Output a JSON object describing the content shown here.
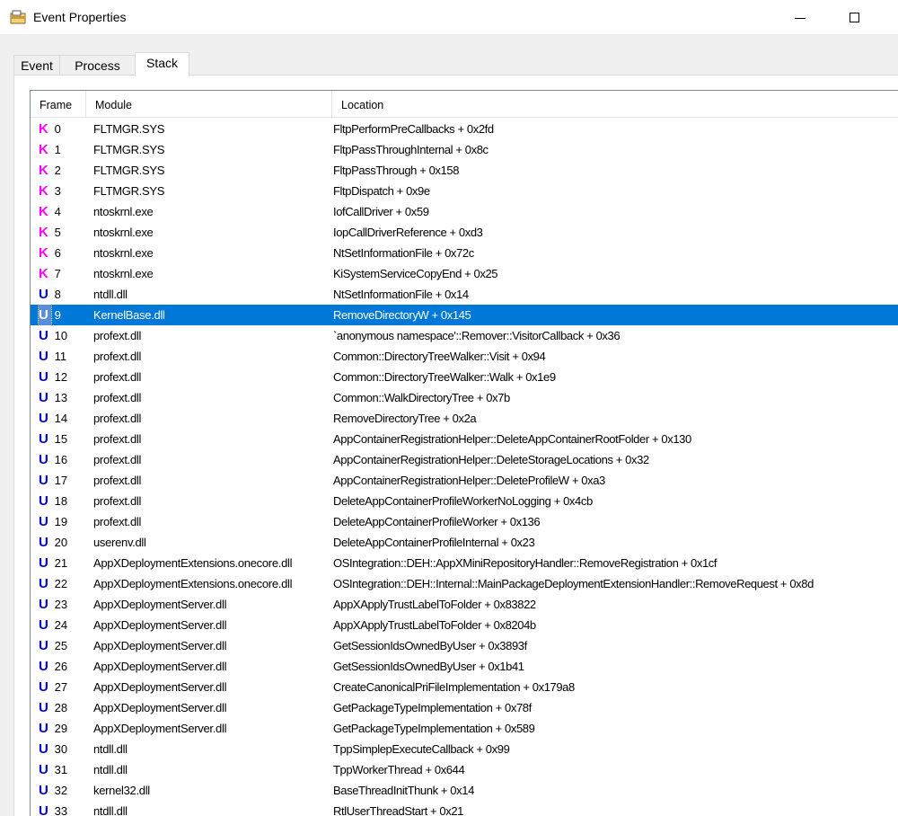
{
  "window": {
    "title": "Event Properties",
    "icon": "event-properties-icon"
  },
  "tabs": [
    {
      "label": "Event",
      "active": false
    },
    {
      "label": "Process",
      "active": false
    },
    {
      "label": "Stack",
      "active": true
    }
  ],
  "columns": {
    "frame": "Frame",
    "module": "Module",
    "location": "Location"
  },
  "mode_colors": {
    "K": "#ff00ff",
    "U": "#0000cc"
  },
  "selected_frame": 9,
  "rows": [
    {
      "mode": "K",
      "frame": "0",
      "module": "FLTMGR.SYS",
      "location": "FltpPerformPreCallbacks + 0x2fd"
    },
    {
      "mode": "K",
      "frame": "1",
      "module": "FLTMGR.SYS",
      "location": "FltpPassThroughInternal + 0x8c"
    },
    {
      "mode": "K",
      "frame": "2",
      "module": "FLTMGR.SYS",
      "location": "FltpPassThrough + 0x158"
    },
    {
      "mode": "K",
      "frame": "3",
      "module": "FLTMGR.SYS",
      "location": "FltpDispatch + 0x9e"
    },
    {
      "mode": "K",
      "frame": "4",
      "module": "ntoskrnl.exe",
      "location": "IofCallDriver + 0x59"
    },
    {
      "mode": "K",
      "frame": "5",
      "module": "ntoskrnl.exe",
      "location": "IopCallDriverReference + 0xd3"
    },
    {
      "mode": "K",
      "frame": "6",
      "module": "ntoskrnl.exe",
      "location": "NtSetInformationFile + 0x72c"
    },
    {
      "mode": "K",
      "frame": "7",
      "module": "ntoskrnl.exe",
      "location": "KiSystemServiceCopyEnd + 0x25"
    },
    {
      "mode": "U",
      "frame": "8",
      "module": "ntdll.dll",
      "location": "NtSetInformationFile + 0x14"
    },
    {
      "mode": "U",
      "frame": "9",
      "module": "KernelBase.dll",
      "location": "RemoveDirectoryW + 0x145"
    },
    {
      "mode": "U",
      "frame": "10",
      "module": "profext.dll",
      "location": "`anonymous namespace'::Remover::VisitorCallback + 0x36"
    },
    {
      "mode": "U",
      "frame": "11",
      "module": "profext.dll",
      "location": "Common::DirectoryTreeWalker::Visit + 0x94"
    },
    {
      "mode": "U",
      "frame": "12",
      "module": "profext.dll",
      "location": "Common::DirectoryTreeWalker::Walk + 0x1e9"
    },
    {
      "mode": "U",
      "frame": "13",
      "module": "profext.dll",
      "location": "Common::WalkDirectoryTree + 0x7b"
    },
    {
      "mode": "U",
      "frame": "14",
      "module": "profext.dll",
      "location": "RemoveDirectoryTree + 0x2a"
    },
    {
      "mode": "U",
      "frame": "15",
      "module": "profext.dll",
      "location": "AppContainerRegistrationHelper::DeleteAppContainerRootFolder + 0x130"
    },
    {
      "mode": "U",
      "frame": "16",
      "module": "profext.dll",
      "location": "AppContainerRegistrationHelper::DeleteStorageLocations + 0x32"
    },
    {
      "mode": "U",
      "frame": "17",
      "module": "profext.dll",
      "location": "AppContainerRegistrationHelper::DeleteProfileW + 0xa3"
    },
    {
      "mode": "U",
      "frame": "18",
      "module": "profext.dll",
      "location": "DeleteAppContainerProfileWorkerNoLogging + 0x4cb"
    },
    {
      "mode": "U",
      "frame": "19",
      "module": "profext.dll",
      "location": "DeleteAppContainerProfileWorker + 0x136"
    },
    {
      "mode": "U",
      "frame": "20",
      "module": "userenv.dll",
      "location": "DeleteAppContainerProfileInternal + 0x23"
    },
    {
      "mode": "U",
      "frame": "21",
      "module": "AppXDeploymentExtensions.onecore.dll",
      "location": "OSIntegration::DEH::AppXMiniRepositoryHandler::RemoveRegistration + 0x1cf"
    },
    {
      "mode": "U",
      "frame": "22",
      "module": "AppXDeploymentExtensions.onecore.dll",
      "location": "OSIntegration::DEH::Internal::MainPackageDeploymentExtensionHandler::RemoveRequest + 0x8d"
    },
    {
      "mode": "U",
      "frame": "23",
      "module": "AppXDeploymentServer.dll",
      "location": "AppXApplyTrustLabelToFolder + 0x83822"
    },
    {
      "mode": "U",
      "frame": "24",
      "module": "AppXDeploymentServer.dll",
      "location": "AppXApplyTrustLabelToFolder + 0x8204b"
    },
    {
      "mode": "U",
      "frame": "25",
      "module": "AppXDeploymentServer.dll",
      "location": "GetSessionIdsOwnedByUser + 0x3893f"
    },
    {
      "mode": "U",
      "frame": "26",
      "module": "AppXDeploymentServer.dll",
      "location": "GetSessionIdsOwnedByUser + 0x1b41"
    },
    {
      "mode": "U",
      "frame": "27",
      "module": "AppXDeploymentServer.dll",
      "location": "CreateCanonicalPriFileImplementation + 0x179a8"
    },
    {
      "mode": "U",
      "frame": "28",
      "module": "AppXDeploymentServer.dll",
      "location": "GetPackageTypeImplementation + 0x78f"
    },
    {
      "mode": "U",
      "frame": "29",
      "module": "AppXDeploymentServer.dll",
      "location": "GetPackageTypeImplementation + 0x589"
    },
    {
      "mode": "U",
      "frame": "30",
      "module": "ntdll.dll",
      "location": "TppSimplepExecuteCallback + 0x99"
    },
    {
      "mode": "U",
      "frame": "31",
      "module": "ntdll.dll",
      "location": "TppWorkerThread + 0x644"
    },
    {
      "mode": "U",
      "frame": "32",
      "module": "kernel32.dll",
      "location": "BaseThreadInitThunk + 0x14"
    },
    {
      "mode": "U",
      "frame": "33",
      "module": "ntdll.dll",
      "location": "RtlUserThreadStart + 0x21"
    }
  ]
}
